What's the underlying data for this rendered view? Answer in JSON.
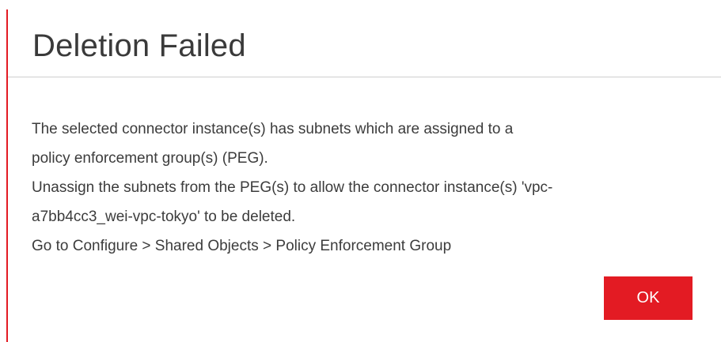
{
  "dialog": {
    "title": "Deletion Failed",
    "message_lines": [
      "The selected connector instance(s) has subnets which are assigned to a",
      "policy enforcement group(s) (PEG).",
      "Unassign the subnets from the PEG(s) to allow the connector instance(s) 'vpc-",
      "a7bb4cc3_wei-vpc-tokyo' to be deleted.",
      "Go to Configure > Shared Objects > Policy Enforcement Group"
    ],
    "ok_label": "OK"
  },
  "colors": {
    "accent": "#e31b23",
    "title_text": "#3a3a3a",
    "body_text": "#3c3c3c",
    "divider": "#cfcfcf"
  }
}
